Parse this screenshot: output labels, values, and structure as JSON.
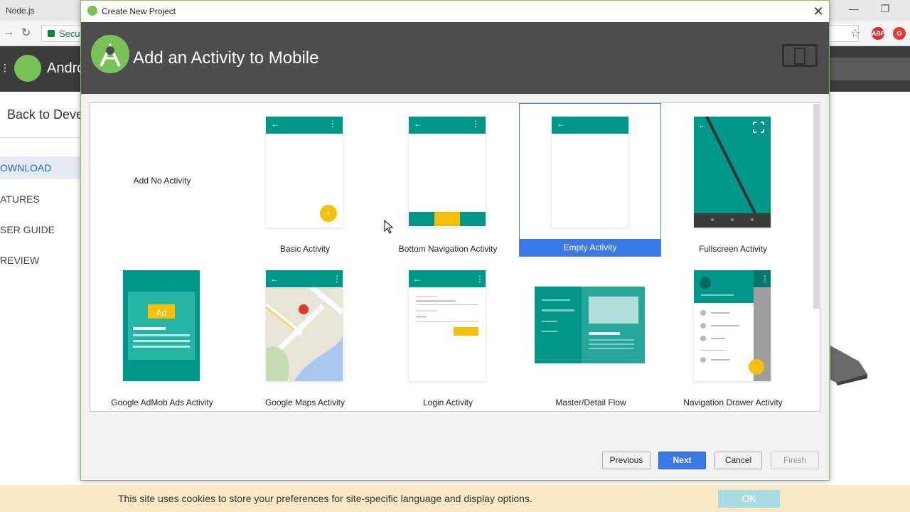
{
  "browser": {
    "tab_title": "Node.js",
    "address_secure_text": "Secu",
    "site_title": "Andro",
    "sidebar": {
      "back_label": "Back to Deve",
      "items": [
        {
          "label": "OWNLOAD",
          "active": true
        },
        {
          "label": "ATURES",
          "active": false
        },
        {
          "label": "SER GUIDE",
          "active": false
        },
        {
          "label": "REVIEW",
          "active": false
        }
      ]
    },
    "extensions": [
      {
        "name": "star-icon"
      },
      {
        "name": "adblock-icon",
        "text": "ABP"
      },
      {
        "name": "opera-icon"
      }
    ],
    "cookie_text": "This site uses cookies to store your preferences for site-specific language and display options.",
    "cookie_ok": "OK"
  },
  "dialog": {
    "title": "Create New Project",
    "banner_title": "Add an Activity to Mobile",
    "activities": [
      {
        "label": "Add No Activity",
        "selected": false
      },
      {
        "label": "Basic Activity",
        "selected": false
      },
      {
        "label": "Bottom Navigation Activity",
        "selected": false
      },
      {
        "label": "Empty Activity",
        "selected": true
      },
      {
        "label": "Fullscreen Activity",
        "selected": false
      },
      {
        "label": "Google AdMob Ads Activity",
        "selected": false
      },
      {
        "label": "Google Maps Activity",
        "selected": false
      },
      {
        "label": "Login Activity",
        "selected": false
      },
      {
        "label": "Master/Detail Flow",
        "selected": false
      },
      {
        "label": "Navigation Drawer Activity",
        "selected": false
      }
    ],
    "ad_badge": "Ad",
    "buttons": {
      "previous": "Previous",
      "next": "Next",
      "cancel": "Cancel",
      "finish": "Finish"
    },
    "colors": {
      "teal": "#009688",
      "amber": "#f5bf0a",
      "selection": "#3b78e7",
      "banner": "#4d4d4d"
    }
  }
}
